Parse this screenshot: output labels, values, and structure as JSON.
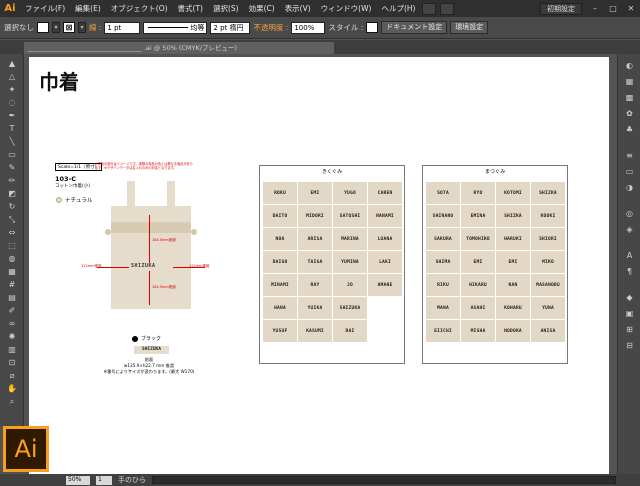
{
  "app": {
    "logo": "Ai",
    "menu": [
      "ファイル(F)",
      "編集(E)",
      "オブジェクト(O)",
      "書式(T)",
      "選択(S)",
      "効果(C)",
      "表示(V)",
      "ウィンドウ(W)",
      "ヘルプ(H)"
    ],
    "workspace": "初期設定"
  },
  "control_bar": {
    "selection": "選択なし",
    "stroke_label": "線 :",
    "stroke_weight": "1 pt",
    "line_style": "均等",
    "brush": "2 pt 楕円",
    "opacity_label": "不透明度 :",
    "opacity_value": "100%",
    "style_label": "スタイル :",
    "doc_setup_button": "ドキュメント設定",
    "prefs_button": "環境設定"
  },
  "document_tab": "___________________________________ .ai @ 50% (CMYK/プレビュー)",
  "statusbar": {
    "zoom": "50%",
    "page": "1",
    "tool": "手のひら"
  },
  "artboard": {
    "title": "巾着",
    "spec": {
      "scale": "Scale=1/1（原寸）",
      "note": "※黒色の部分はイメージです。実際の商品の色とは異なる場合があります。※デザインデータは名入れのみの対応となります。",
      "code": "103-C",
      "subtitle": "コットン巾着(小)",
      "color": "ナチュラル",
      "bag_name": "SHIZUKA",
      "dim_height_top": "184.5mm推奨",
      "dim_height_bottom": "184.5mm推奨",
      "dim_width_left": "122mm推奨",
      "dim_width_right": "122mm推奨",
      "print_color": "ブラック",
      "sample": "SHIZUKA",
      "foot_line1": "前面",
      "foot_line2": "w135.9×h22.7 mm 推奨",
      "foot_line3": "※番号によりサイズが変わります。(最大 W170)"
    },
    "panels": [
      {
        "title": "きくぐみ",
        "names": [
          "ROKU",
          "EMI",
          "YUGO",
          "CAREN",
          "DAITO",
          "MIDORI",
          "SATOSHI",
          "NANAMI",
          "NOA",
          "ARISA",
          "MARINA",
          "LUANA",
          "DAIGO",
          "TAIGA",
          "YUMINA",
          "LAKI",
          "MINAMI",
          "RAY",
          "JO",
          "AMANE",
          "HANA",
          "YUIKA",
          "SHIZUKA",
          "",
          "YUSUF",
          "KASUMI",
          "DAI"
        ]
      },
      {
        "title": "まつぐみ",
        "names": [
          "SOTA",
          "RYO",
          "KOTOMI",
          "SHIZKA",
          "SHINANO",
          "EMINA",
          "SHIZKA",
          "KOOKI",
          "SAKURA",
          "TOMOHIRO",
          "HARUKI",
          "SHIORI",
          "SHIMA",
          "EMI",
          "EMI",
          "MIKO",
          "RIKU",
          "HIKARU",
          "NAN",
          "MASANOBU",
          "MANA",
          "ASAHI",
          "KOHARU",
          "YUNA",
          "EIICHI",
          "MISHA",
          "NODOKA",
          "ANISA"
        ]
      }
    ]
  },
  "colors": {
    "ui_dark": "#2f2f2f",
    "ui_mid": "#535353",
    "accent": "#f7a01f",
    "name_tile": "#e2d8c5",
    "dimension": "#dd0000"
  }
}
